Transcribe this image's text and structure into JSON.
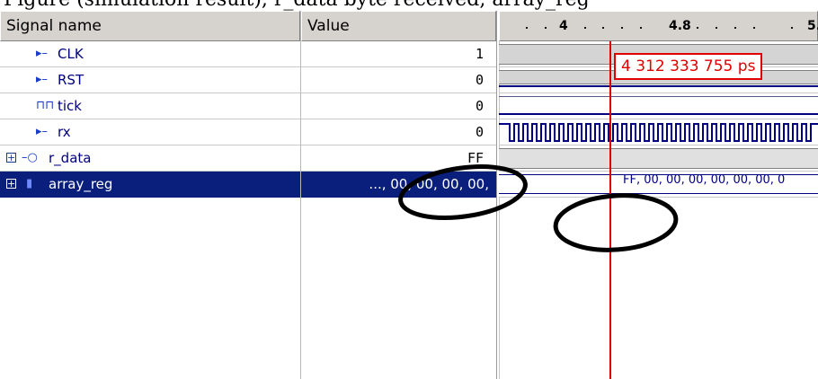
{
  "header_fragment": "Figure (simulation result), r_data byte received, array_reg",
  "columns": {
    "signal_name": "Signal name",
    "value": "Value"
  },
  "timeline": {
    "ticks": [
      "4",
      "4.8",
      "5."
    ]
  },
  "cursor": {
    "time": "4 312 333 755 ps",
    "color": "#e00000"
  },
  "signals": [
    {
      "name": "CLK",
      "icon": "input-pin-icon",
      "value": "1"
    },
    {
      "name": "RST",
      "icon": "input-pin-icon",
      "value": "0"
    },
    {
      "name": "tick",
      "icon": "clock-pulse-icon",
      "value": "0"
    },
    {
      "name": "rx",
      "icon": "input-pin-icon",
      "value": "0"
    },
    {
      "name": "r_data",
      "icon": "output-bus-icon",
      "value": "FF",
      "expandable": true
    },
    {
      "name": "array_reg",
      "icon": "register-icon",
      "value": "..., 00, 00, 00, 00,",
      "expandable": true,
      "selected": true,
      "wave_text": "FF, 00, 00, 00, 00, 00, 00, 0"
    }
  ],
  "colors": {
    "selection": "#0a1f7c",
    "wave_line": "#000080",
    "annotation": "#000000"
  }
}
